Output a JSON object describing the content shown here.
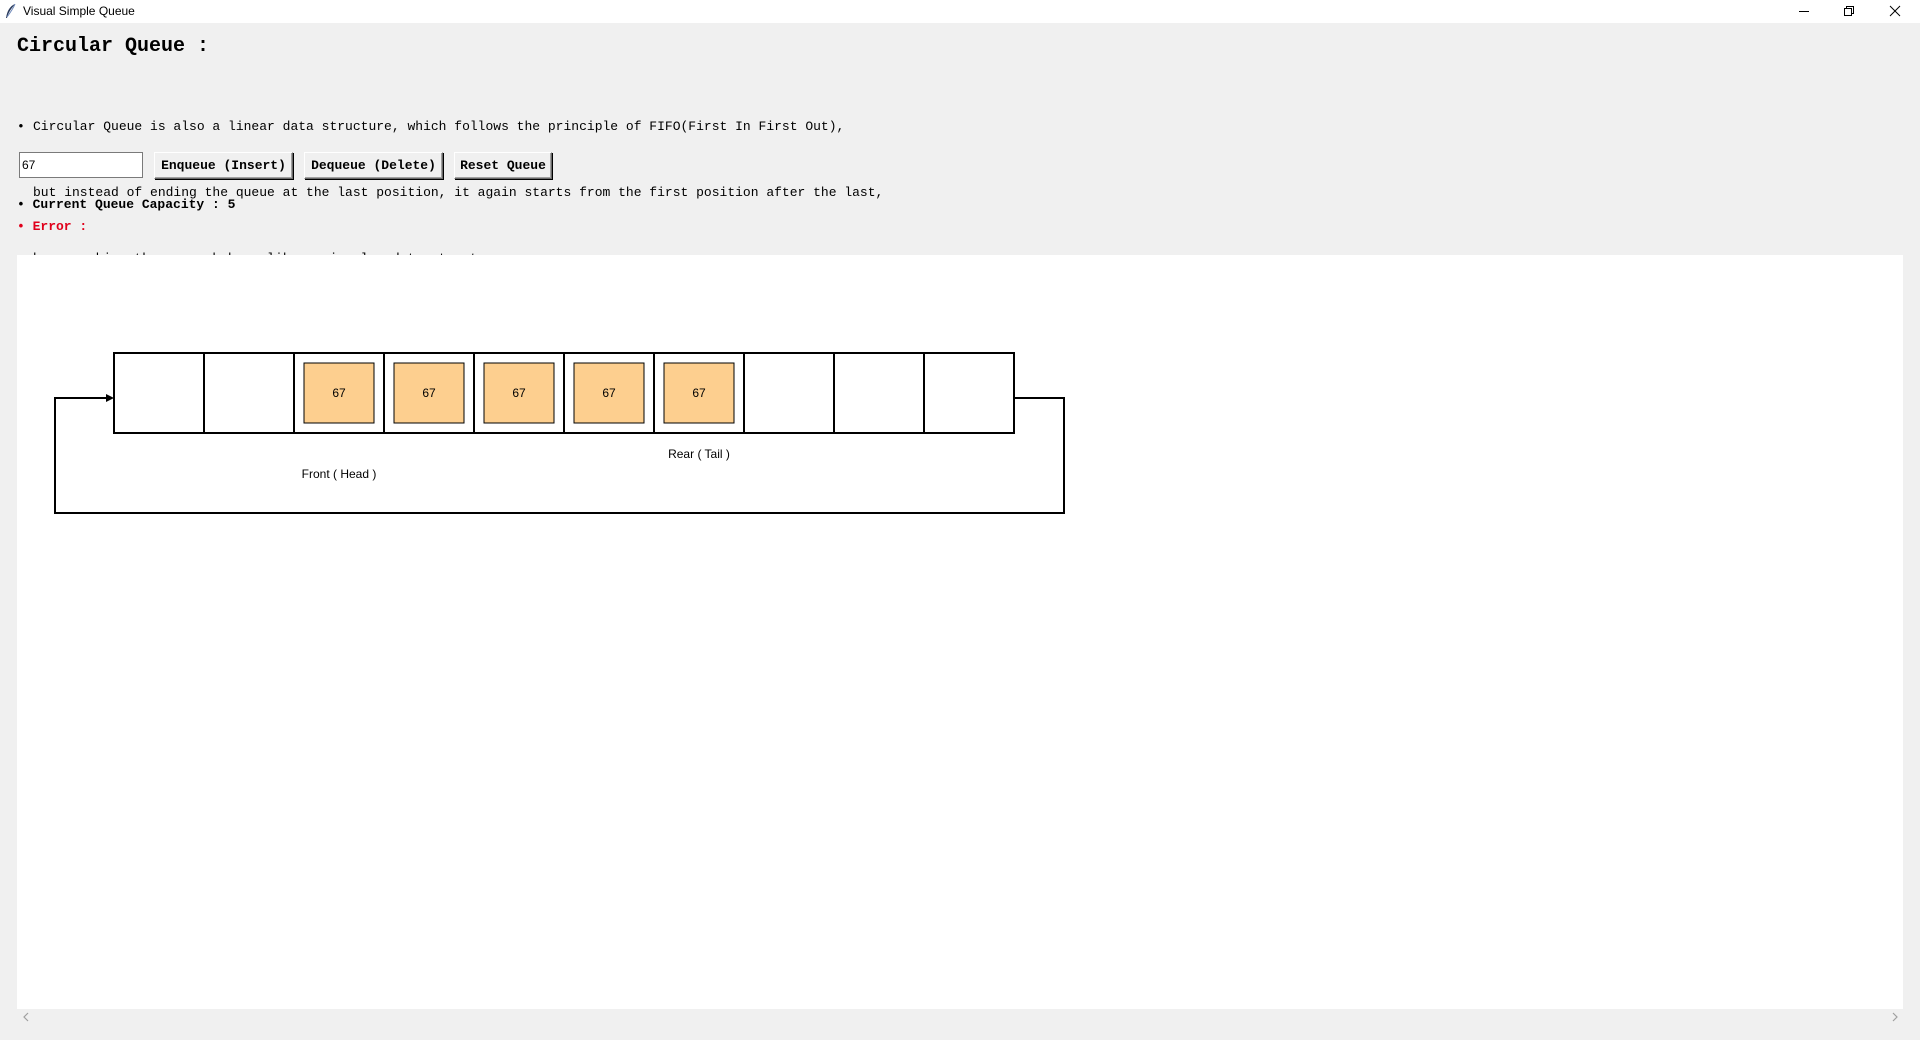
{
  "window": {
    "title": "Visual Simple Queue",
    "icon": "feather-icon",
    "controls": [
      "minimize-icon",
      "restore-icon",
      "close-icon"
    ]
  },
  "header": {
    "title": "Circular Queue :",
    "description": {
      "bullet": "•",
      "lines": [
        "Circular Queue is also a linear data structure, which follows the principle of FIFO(First In First Out),",
        "but instead of ending the queue at the last position, it again starts from the first position after the last,",
        "hence making the queue behave like a circular data structure."
      ]
    }
  },
  "controls": {
    "input_value": "67",
    "enqueue_label": "Enqueue (Insert)",
    "dequeue_label": "Dequeue (Delete)",
    "reset_label": "Reset Queue"
  },
  "status": {
    "capacity": "• Current Queue Capacity : 5",
    "error": "• Error :"
  },
  "queue": {
    "slots": [
      "",
      "",
      "67",
      "67",
      "67",
      "67",
      "67",
      "",
      "",
      ""
    ],
    "front_index": 2,
    "rear_index": 6,
    "front_label": "Front ( Head )",
    "rear_label": "Rear ( Tail )"
  },
  "colors": {
    "filled_cell": "#fdcf8f",
    "error_text": "#e0001b",
    "canvas_bg": "#ffffff",
    "window_bg": "#f0f0f0"
  }
}
